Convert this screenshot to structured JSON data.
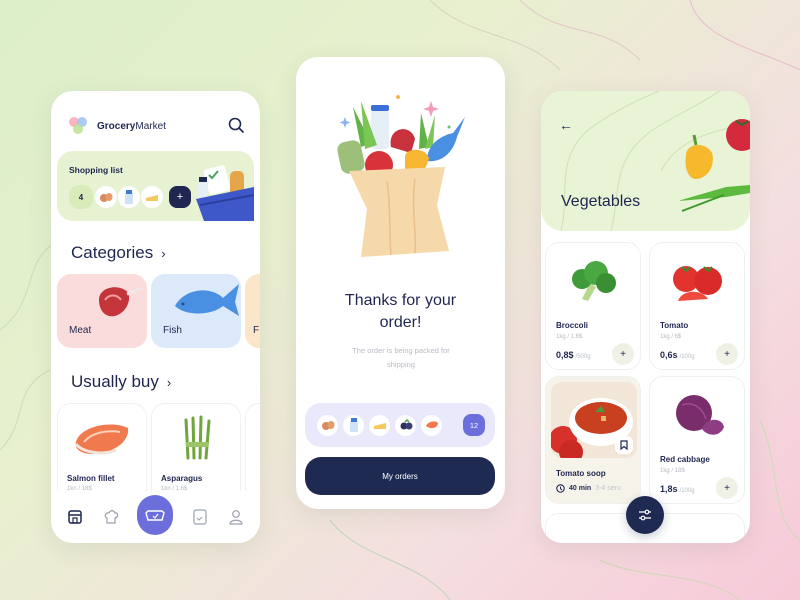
{
  "colors": {
    "navy": "#1f2650",
    "accent_purple": "#6c6fdb",
    "green_card": "#e7f2d3",
    "meat_card": "#fbdcdc",
    "fish_card": "#dbe9fb",
    "orange_card": "#fbe6c9"
  },
  "home": {
    "brand_bold": "Grocery",
    "brand_light": "Market",
    "search_icon": "search-icon",
    "shopping_list": {
      "title": "Shopping list",
      "count": "4",
      "items": [
        "eggs",
        "milk",
        "cheese"
      ],
      "add_label": "+"
    },
    "categories_title": "Categories",
    "categories": [
      {
        "label": "Meat"
      },
      {
        "label": "Fish"
      },
      {
        "label": "F"
      }
    ],
    "usually_buy_title": "Usually buy",
    "usually_buy": [
      {
        "name": "Salmon fillet",
        "sub": "1kn / 18$"
      },
      {
        "name": "Asparagus",
        "sub": "1kn / 1.6$"
      }
    ],
    "nav": [
      {
        "icon": "store-icon"
      },
      {
        "icon": "chef-hat-icon"
      },
      {
        "icon": "cart-icon",
        "active": true
      },
      {
        "icon": "list-icon"
      },
      {
        "icon": "user-icon"
      }
    ]
  },
  "confirmation": {
    "title_line1": "Thanks for your",
    "title_line2": "order!",
    "subtitle_line1": "The order is being packed for",
    "subtitle_line2": "shipping",
    "order_items": [
      "eggs",
      "milk",
      "cheese",
      "blueberries",
      "salmon"
    ],
    "order_count": "12",
    "my_orders_label": "My orders"
  },
  "vegetables": {
    "back_icon": "←",
    "title": "Vegetables",
    "products": [
      {
        "name": "Broccoli",
        "sub": "1kg / 1.6$",
        "price": "0,8$",
        "unit": "/500g",
        "add": "+"
      },
      {
        "name": "Tomato",
        "sub": "1kg / 6$",
        "price": "0,6s",
        "unit": "/100g",
        "add": "+"
      },
      {
        "name": "Red cabbage",
        "sub": "1kg / 18$",
        "price": "1,8s",
        "unit": "/100g",
        "add": "+"
      }
    ],
    "recipe": {
      "name": "Tomato soop",
      "time": "40 min",
      "servings": "3-4 serv."
    }
  }
}
